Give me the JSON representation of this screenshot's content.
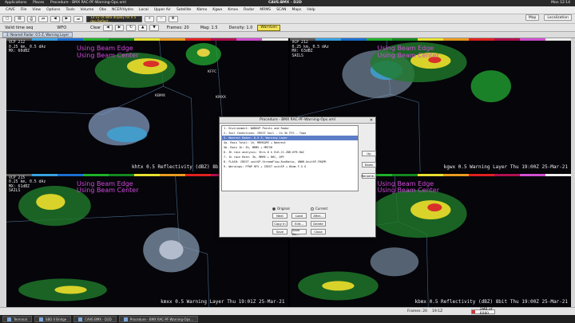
{
  "system": {
    "applications": "Applications",
    "places": "Places",
    "proc_title": "Procedure - BMX RAC-PF-Warning-Ops.xml",
    "window_title": "CAVE:BMX - D2D",
    "clock": "Mon 12:14"
  },
  "menu": [
    "CAVE",
    "File",
    "View",
    "Options",
    "Tools",
    "Volume",
    "Obs",
    "NCEP/Hydro",
    "Local",
    "Upper Air",
    "Satellite",
    "Kbmx",
    "Kgwx",
    "Kmxx",
    "Radar",
    "MRMS",
    "SCAN",
    "Maps",
    "Help"
  ],
  "toolbar": {
    "valid_time": "Valid time seq",
    "wfo": "WFO",
    "clear_label": "Clear",
    "loop_combo": "12:12 UI data display for 0.5 deg Reflect...",
    "frames": "Frames: 20",
    "mag": "Mag: 1.5",
    "density": "Density: 1.0",
    "warngen": "WarnGen",
    "map_button": "Map",
    "localization_button": "Localization"
  },
  "view_tab": "2: Nearest Radar: 0.5 Z, Warning Layer",
  "colors": {
    "beam_label": "#d04ad8",
    "selected_step": "#5d7dc6",
    "warngen": "#f3e45a"
  },
  "panes": [
    {
      "vcp": "VCP 212",
      "res": "0.25 km, 0.5 dAz",
      "mx": "MX: 60dBZ",
      "mode": "",
      "beam": [
        "Using Beam Edge",
        "Using Beam Center"
      ],
      "legend": "khtx 0.5  Reflectivity (dBZ) 8bit  Thu 19:00Z 25-Mar-21"
    },
    {
      "vcp": "VCP 212",
      "res": "0.25 km, 0.5 dAz",
      "mx": "MX: 63dBZ",
      "mode": "SAILS",
      "beam": [
        "Using Beam Edge",
        "Using Beam Center"
      ],
      "legend": "kgwx 0.5  Warning Layer  Thu 19:00Z 25-Mar-21"
    },
    {
      "vcp": "VCP 215",
      "res": "0.25 km, 0.5 dAz",
      "mx": "MX: 61dBZ",
      "mode": "SAILS",
      "beam": [
        "Using Beam Edge",
        "Using Beam Center"
      ],
      "legend": "kmxx 0.5  Warning Layer  Thu 19:01Z 25-Mar-21"
    },
    {
      "vcp": "VCP 212",
      "res": "0.25 km, 0.5 dAz",
      "mx": "MX: 62dBZ",
      "mode": "SAILS",
      "beam": [
        "Using Beam Edge",
        "Using Beam Center"
      ],
      "legend": "kbmx 0.5  Reflectivity (dBZ) 8bit  Thu 19:00Z 25-Mar-21"
    }
  ],
  "sites": [
    "KBMX",
    "KFFC",
    "KMXX"
  ],
  "dialog": {
    "title": "Procedure - BMX RAC-PF-Warning-Ops.xml",
    "steps": [
      "1. Environment: WOBOXP Points and Radar",
      "2. Soil Conditions: CREST Soil - 1h 3h FFG - Topo",
      "3. Nearest Radar: 0.5 Z, Warning Layer",
      "4a. Rain Total: 1h, MRMSQPE + Nearest",
      "5b. Rain 1h: 3h, MRMS + MRTSR",
      "6. 3h rain analysis: 3hrs 6 h ELR-CC-ZDR-KPE-RAC",
      "7. 1h rain Rate: 3h, MRMS + RHC, QPY",
      "8. FLASH: CREST unitSP-StreamFlow-RunRatio, UNHR-UnitSP-FRQPR",
      "9. Warnings: FFWP HFS + CREST unitSP + 6hmm F.S G"
    ],
    "side_buttons": [
      "Up",
      "Down",
      "Rename..."
    ],
    "radio_original": "Original",
    "radio_current": "Current",
    "buttons": [
      "Next",
      "Load",
      "After...",
      "Copy In",
      "Edit...",
      "Delete",
      "Save",
      "Save As...",
      "Close"
    ]
  },
  "status": {
    "frames": "Frames: 20",
    "time": "19:1Z",
    "mem": "2MB of 6080"
  },
  "taskbar": [
    "Terminal",
    "SBD II Bridge",
    "CAVE:BMX - D2D",
    "Procedure - BMX RAC-PF-Warning-Ops..."
  ]
}
